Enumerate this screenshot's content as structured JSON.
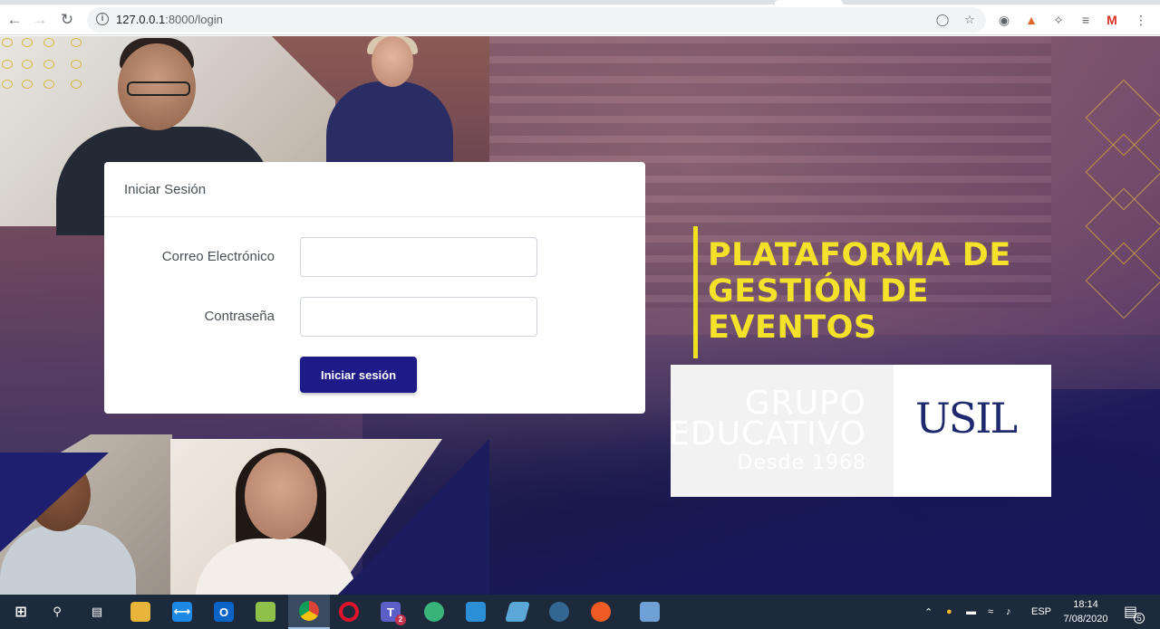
{
  "browser": {
    "url_host": "127.0.0.1",
    "url_path": ":8000/login",
    "nav": {
      "back_icon": "arrow-left",
      "forward_icon": "arrow-right",
      "reload_icon": "reload"
    }
  },
  "login": {
    "card_title": "Iniciar Sesión",
    "email_label": "Correo Electrónico",
    "email_value": "",
    "password_label": "Contraseña",
    "password_value": "",
    "submit_label": "Iniciar sesión",
    "button_color": "#1e1a87"
  },
  "brand": {
    "title_lines": [
      "PLATAFORMA DE",
      "GESTIÓN DE",
      "EVENTOS"
    ],
    "title_color": "#f4e22a",
    "logo_text_lines": [
      "GRUPO",
      "EDUCATIVO",
      "Desde 1968"
    ],
    "logo_mark": "USIL"
  },
  "taskbar": {
    "items": [
      "windows-start",
      "search",
      "task-view",
      "file-explorer",
      "vscode",
      "outlook",
      "notepad",
      "chrome",
      "opera",
      "teams",
      "app-green",
      "photos",
      "app-blue",
      "postgres",
      "postman",
      "network"
    ],
    "teams_badge": "2",
    "language": "ESP",
    "time": "18:14",
    "date": "7/08/2020",
    "notification_count": "5"
  }
}
